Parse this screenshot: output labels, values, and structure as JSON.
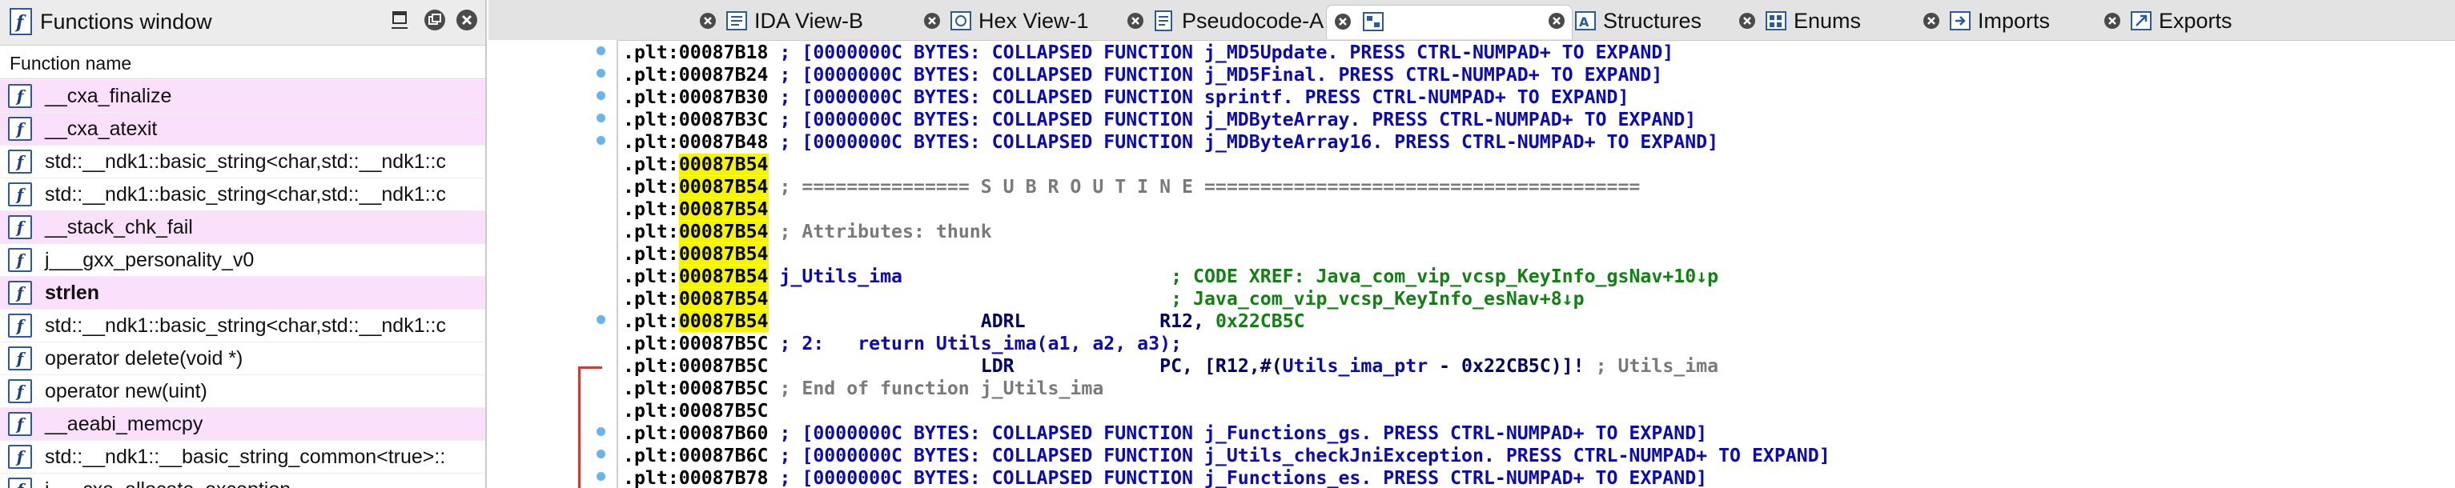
{
  "functions_window": {
    "title": "Functions window",
    "column_header": "Function name",
    "items": [
      {
        "name": "__cxa_finalize",
        "highlight": true,
        "bold": false
      },
      {
        "name": "__cxa_atexit",
        "highlight": true,
        "bold": false
      },
      {
        "name": "std::__ndk1::basic_string<char,std::__ndk1::c",
        "highlight": false,
        "bold": false
      },
      {
        "name": "std::__ndk1::basic_string<char,std::__ndk1::c",
        "highlight": false,
        "bold": false
      },
      {
        "name": "__stack_chk_fail",
        "highlight": true,
        "bold": false
      },
      {
        "name": "j___gxx_personality_v0",
        "highlight": false,
        "bold": false
      },
      {
        "name": "strlen",
        "highlight": true,
        "bold": true
      },
      {
        "name": "std::__ndk1::basic_string<char,std::__ndk1::c",
        "highlight": false,
        "bold": false
      },
      {
        "name": "operator delete(void *)",
        "highlight": false,
        "bold": false
      },
      {
        "name": "operator new(uint)",
        "highlight": false,
        "bold": false
      },
      {
        "name": "__aeabi_memcpy",
        "highlight": true,
        "bold": false
      },
      {
        "name": "std::__ndk1::__basic_string_common<true>::",
        "highlight": false,
        "bold": false
      },
      {
        "name": "j___cxa_allocate_exception",
        "highlight": false,
        "bold": false
      }
    ],
    "function_icon_glyph": "f",
    "icons": {
      "title": "functions-window-icon",
      "restore": "restore-icon",
      "float": "float-window-icon",
      "close": "close-icon",
      "function": "function-icon"
    }
  },
  "tabs": [
    {
      "label": "IDA View-B",
      "icon": "ida-view-icon",
      "active": false
    },
    {
      "label": "Hex View-1",
      "icon": "hex-view-icon",
      "active": false
    },
    {
      "label": "Pseudocode-A",
      "icon": "pseudocode-icon",
      "active": false
    },
    {
      "label": "",
      "icon": "graph-view-icon",
      "active": true
    },
    {
      "label": "Structures",
      "icon": "structures-icon",
      "active": false
    },
    {
      "label": "Enums",
      "icon": "enums-icon",
      "active": false
    },
    {
      "label": "Imports",
      "icon": "imports-icon",
      "active": false
    },
    {
      "label": "Exports",
      "icon": "exports-icon",
      "active": false
    }
  ],
  "code": {
    "lines": [
      {
        "addr": ".plt:00087B18",
        "kind": "collapsed",
        "text": " ; [0000000C BYTES: COLLAPSED FUNCTION j_MD5Update. PRESS CTRL-NUMPAD+ TO EXPAND]"
      },
      {
        "addr": ".plt:00087B24",
        "kind": "collapsed",
        "text": " ; [0000000C BYTES: COLLAPSED FUNCTION j_MD5Final. PRESS CTRL-NUMPAD+ TO EXPAND]"
      },
      {
        "addr": ".plt:00087B30",
        "kind": "collapsed",
        "text": " ; [0000000C BYTES: COLLAPSED FUNCTION sprintf. PRESS CTRL-NUMPAD+ TO EXPAND]"
      },
      {
        "addr": ".plt:00087B3C",
        "kind": "collapsed",
        "text": " ; [0000000C BYTES: COLLAPSED FUNCTION j_MDByteArray. PRESS CTRL-NUMPAD+ TO EXPAND]"
      },
      {
        "addr": ".plt:00087B48",
        "kind": "collapsed",
        "text": " ; [0000000C BYTES: COLLAPSED FUNCTION j_MDByteArray16. PRESS CTRL-NUMPAD+ TO EXPAND]"
      },
      {
        "addr_prefix": ".plt:",
        "addr_hl": "00087B54",
        "kind": "blank",
        "text": ""
      },
      {
        "addr_prefix": ".plt:",
        "addr_hl": "00087B54",
        "kind": "sep",
        "text": " ; =============== S U B R O U T I N E ======================================="
      },
      {
        "addr_prefix": ".plt:",
        "addr_hl": "00087B54",
        "kind": "blank",
        "text": ""
      },
      {
        "addr_prefix": ".plt:",
        "addr_hl": "00087B54",
        "kind": "comment",
        "text": " ; Attributes: thunk"
      },
      {
        "addr_prefix": ".plt:",
        "addr_hl": "00087B54",
        "kind": "blank",
        "text": ""
      },
      {
        "addr_prefix": ".plt:",
        "addr_hl": "00087B54",
        "kind": "label",
        "label": " j_Utils_ima",
        "pad": "                        ",
        "xref": "; CODE XREF: Java_com_vip_vcsp_KeyInfo_gsNav+10↓p"
      },
      {
        "addr_prefix": ".plt:",
        "addr_hl": "00087B54",
        "kind": "xref2",
        "pad": "                                   ",
        "xref": " ; Java_com_vip_vcsp_KeyInfo_esNav+8↓p"
      },
      {
        "addr_prefix": ".plt:",
        "addr_hl": "00087B54",
        "kind": "insn",
        "pad": "                   ",
        "mnem": "ADRL",
        "pad2": "            ",
        "reg": "R12, ",
        "operand": "0x22CB5C",
        "op_kind": "num"
      },
      {
        "addr": ".plt:00087B5C",
        "kind": "pseudo",
        "text": " ; 2:   return Utils_ima(a1, a2, a3);"
      },
      {
        "addr": ".plt:00087B5C",
        "kind": "ldr",
        "pad": "                   ",
        "mnem": "LDR",
        "pad2": "             ",
        "reg": "PC, [R12,#(",
        "sym": "Utils_ima_ptr",
        "rest": " - 0x22CB5C)]! ",
        "cmt": "; Utils_ima"
      },
      {
        "addr": ".plt:00087B5C",
        "kind": "comment",
        "text": " ; End of function j_Utils_ima"
      },
      {
        "addr": ".plt:00087B5C",
        "kind": "blank",
        "text": ""
      },
      {
        "addr": ".plt:00087B60",
        "kind": "collapsed",
        "text": " ; [0000000C BYTES: COLLAPSED FUNCTION j_Functions_gs. PRESS CTRL-NUMPAD+ TO EXPAND]"
      },
      {
        "addr": ".plt:00087B6C",
        "kind": "collapsed",
        "text": " ; [0000000C BYTES: COLLAPSED FUNCTION j_Utils_checkJniException. PRESS CTRL-NUMPAD+ TO EXPAND]"
      },
      {
        "addr": ".plt:00087B78",
        "kind": "collapsed",
        "text": " ; [0000000C BYTES: COLLAPSED FUNCTION j_Functions_es. PRESS CTRL-NUMPAD+ TO EXPAND]"
      }
    ],
    "breakpoint_dot_color": "#6ab4ea",
    "highlight_color": "#f5f500"
  }
}
